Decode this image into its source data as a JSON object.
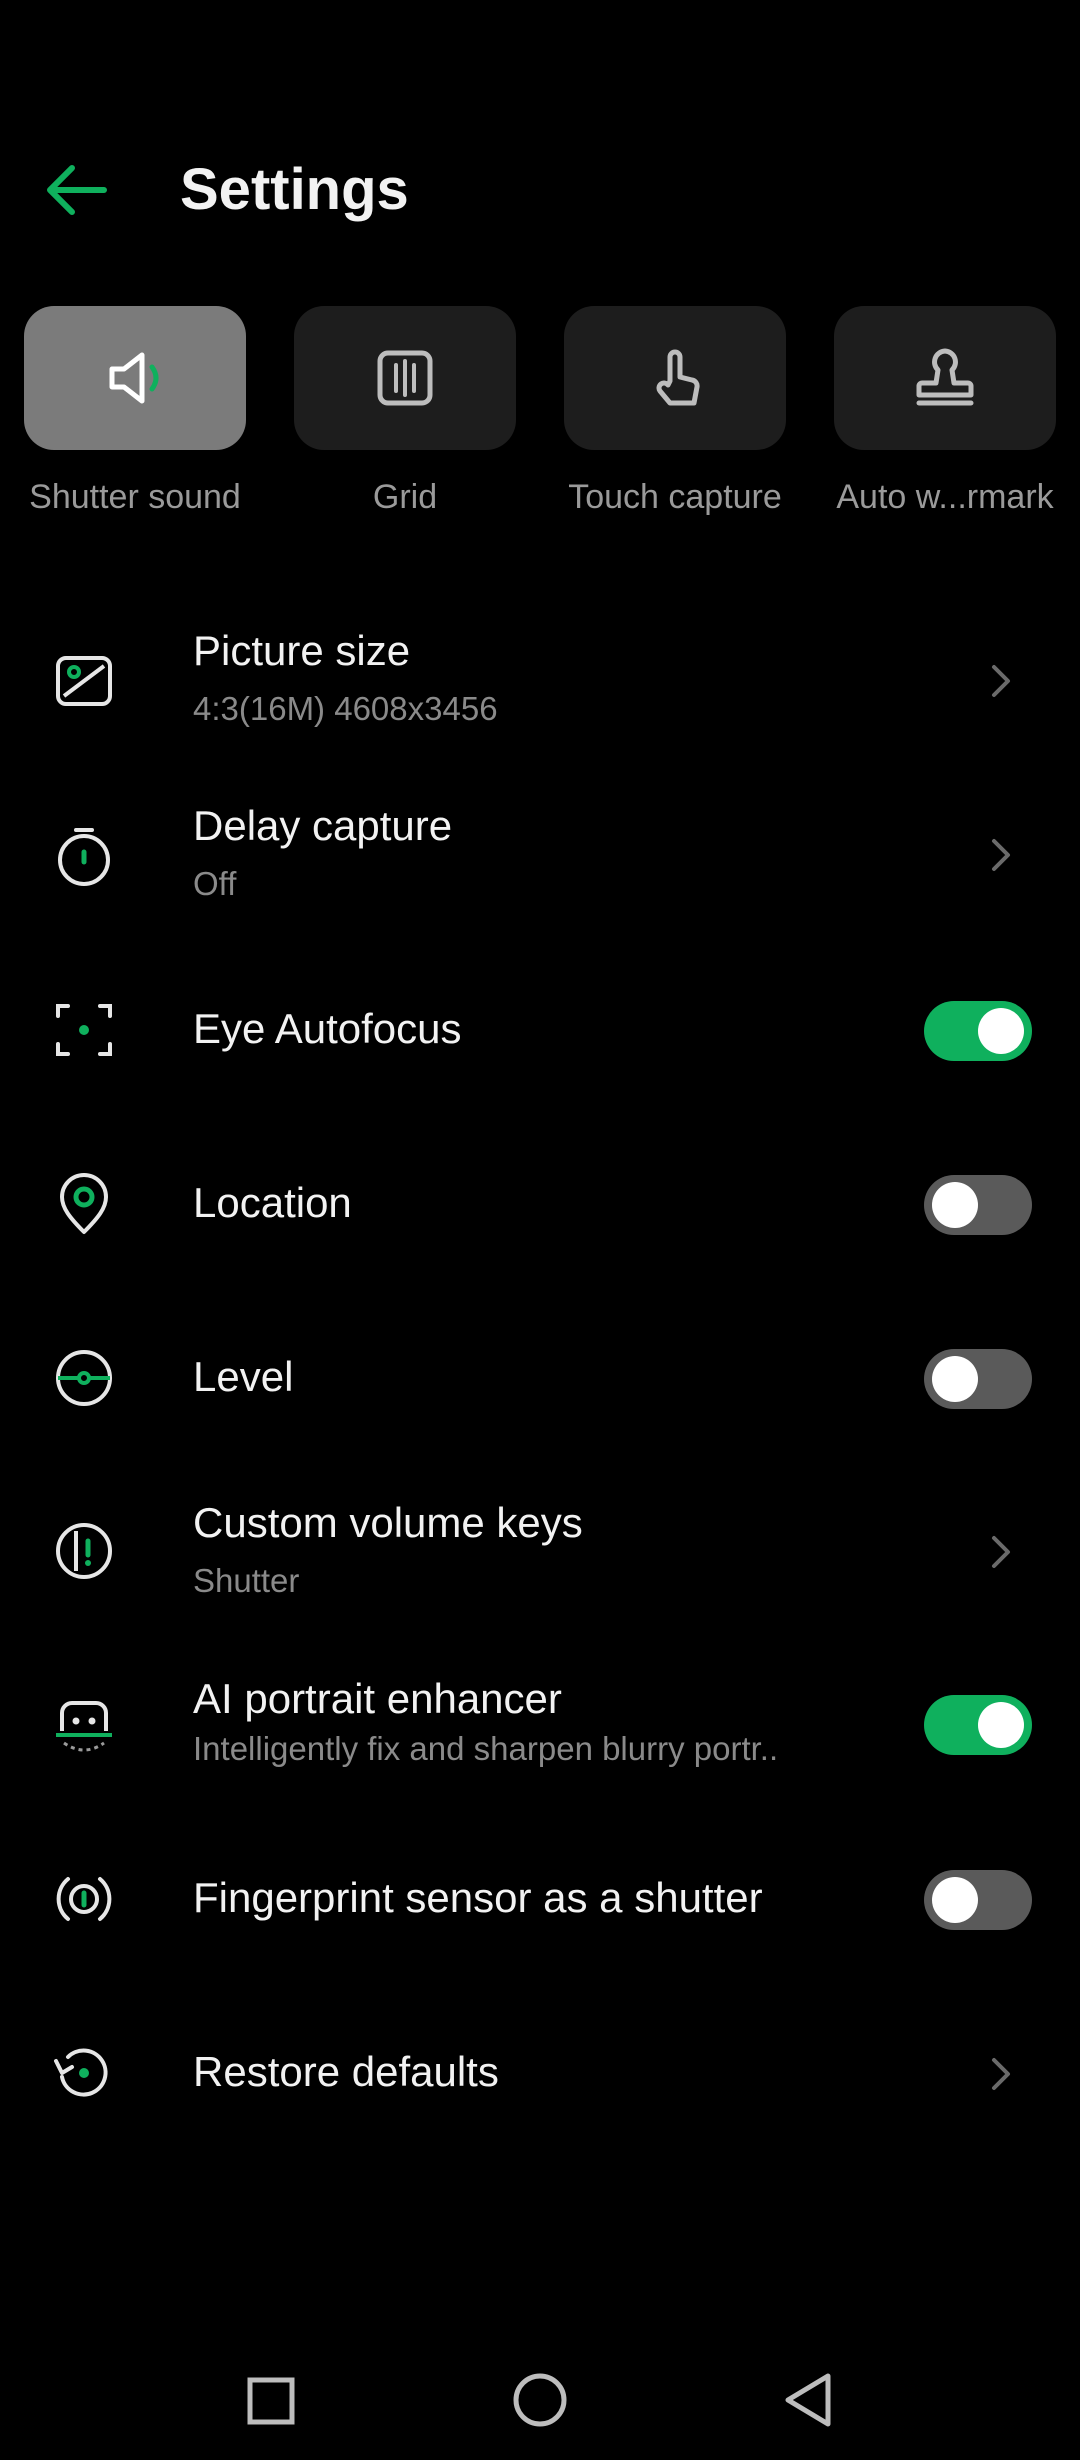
{
  "header": {
    "title": "Settings"
  },
  "quick_toggles": [
    {
      "label": "Shutter sound",
      "icon": "speaker-icon",
      "active": true
    },
    {
      "label": "Grid",
      "icon": "grid-icon",
      "active": false
    },
    {
      "label": "Touch capture",
      "icon": "touch-icon",
      "active": false
    },
    {
      "label": "Auto w...rmark",
      "icon": "stamp-icon",
      "active": false
    }
  ],
  "settings": {
    "picture_size": {
      "title": "Picture size",
      "subtitle": "4:3(16M) 4608x3456"
    },
    "delay_capture": {
      "title": "Delay capture",
      "subtitle": "Off"
    },
    "eye_autofocus": {
      "title": "Eye Autofocus",
      "enabled": true
    },
    "location": {
      "title": "Location",
      "enabled": false
    },
    "level": {
      "title": "Level",
      "enabled": false
    },
    "custom_volume_keys": {
      "title": "Custom volume keys",
      "subtitle": "Shutter"
    },
    "ai_portrait": {
      "title": "AI portrait enhancer",
      "subtitle": "Intelligently fix and sharpen blurry portr..",
      "enabled": true
    },
    "fingerprint": {
      "title": "Fingerprint sensor as a shutter",
      "enabled": false
    },
    "restore": {
      "title": "Restore defaults"
    }
  },
  "colors": {
    "accent": "#0fb05d",
    "background": "#000000",
    "text": "#f2f2f2",
    "subtext": "#8a8a8a"
  }
}
